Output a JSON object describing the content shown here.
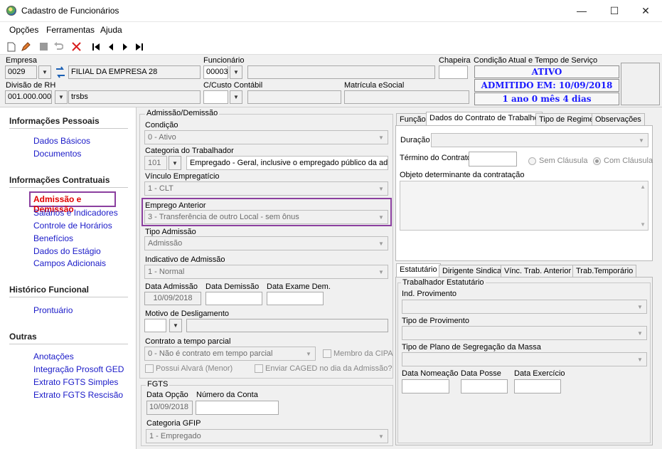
{
  "window": {
    "title": "Cadastro de Funcionários",
    "minimize": "—",
    "maximize": "☐",
    "close": "✕"
  },
  "menu": {
    "opcoes": "Opções",
    "ferramentas": "Ferramentas",
    "ajuda": "Ajuda"
  },
  "header": {
    "empresa_label": "Empresa",
    "empresa_code": "0029",
    "empresa_name": "FILIAL DA EMPRESA 28",
    "funcionario_label": "Funcionário",
    "funcionario_code": "00003",
    "chapeira_label": "Chapeira",
    "condicao_label": "Condição Atual e Tempo de Serviço",
    "status_ativo": "ATIVO",
    "status_admitido": "ADMITIDO EM: 10/09/2018",
    "status_tempo": "1 ano 0 mês 4 dias",
    "divisao_label": "Divisão de RH",
    "divisao_code": "001.000.000",
    "divisao_name": "trsbs",
    "custo_label": "C/Custo Contábil",
    "matricula_label": "Matrícula eSocial"
  },
  "nav": {
    "sec1": "Informações Pessoais",
    "dados_basicos": "Dados Básicos",
    "documentos": "Documentos",
    "sec2": "Informações Contratuais",
    "admissao": "Admissão e Demissão",
    "salarios": "Salários e Indicadores",
    "horarios": "Controle de Horários",
    "beneficios": "Benefícios",
    "estagio": "Dados do Estágio",
    "adicionais": "Campos Adicionais",
    "sec3": "Histórico Funcional",
    "prontuario": "Prontuário",
    "sec4": "Outras",
    "anotacoes": "Anotações",
    "prosoft": "Integração Prosoft GED",
    "fgts_simples": "Extrato FGTS Simples",
    "fgts_rescisao": "Extrato FGTS Rescisão"
  },
  "adm": {
    "group_title": "Admissão/Demissão",
    "condicao_label": "Condição",
    "condicao_value": "0 - Ativo",
    "categoria_label": "Categoria do Trabalhador",
    "categoria_code": "101",
    "categoria_desc": "Empregado - Geral, inclusive o empregado público da administ",
    "vinculo_label": "Vínculo Empregatício",
    "vinculo_value": "1 - CLT",
    "emprego_label": "Emprego Anterior",
    "emprego_value": "3 - Transferência de outro Local - sem ônus",
    "tipo_label": "Tipo Admissão",
    "tipo_value": "Admissão",
    "indicativo_label": "Indicativo de Admissão",
    "indicativo_value": "1 - Normal",
    "data_adm_label": "Data Admissão",
    "data_adm_value": "10/09/2018",
    "data_dem_label": "Data Demissão",
    "data_exame_label": "Data Exame Dem.",
    "motivo_label": "Motivo de Desligamento",
    "contrato_label": "Contrato a tempo parcial",
    "contrato_value": "0 - Não é contrato em tempo parcial",
    "membro_cipa": "Membro da CIPA",
    "alvara": "Possui Alvará (Menor)",
    "caged": "Enviar CAGED no dia da Admissão?"
  },
  "fgts": {
    "group_title": "FGTS",
    "data_opcao_label": "Data Opção",
    "data_opcao_value": "10/09/2018",
    "numero_label": "Número da Conta",
    "gfip_label": "Categoria GFIP",
    "gfip_value": "1 - Empregado"
  },
  "contract_tabs": {
    "funcao": "Função",
    "dados": "Dados do Contrato de Trabalho",
    "regime": "Tipo de Regime",
    "obs": "Observações"
  },
  "contract": {
    "duracao_label": "Duração",
    "termino_label": "Término do Contrato",
    "sem_clausula": "Sem Cláusula",
    "com_clausula": "Com Cláusula",
    "objeto_label": "Objeto determinante da contratação"
  },
  "stat_tabs": {
    "estatutario": "Estatutário",
    "dirigente": "Dirigente Sindical",
    "vinc": "Vínc. Trab. Anterior",
    "temp": "Trab.Temporário"
  },
  "stat": {
    "group_title": "Trabalhador Estatutário",
    "ind_label": "Ind. Provimento",
    "tipo_label": "Tipo de Provimento",
    "plano_label": "Tipo de Plano de Segregação da Massa",
    "nomeacao_label": "Data Nomeação",
    "posse_label": "Data Posse",
    "exercicio_label": "Data Exercício"
  }
}
